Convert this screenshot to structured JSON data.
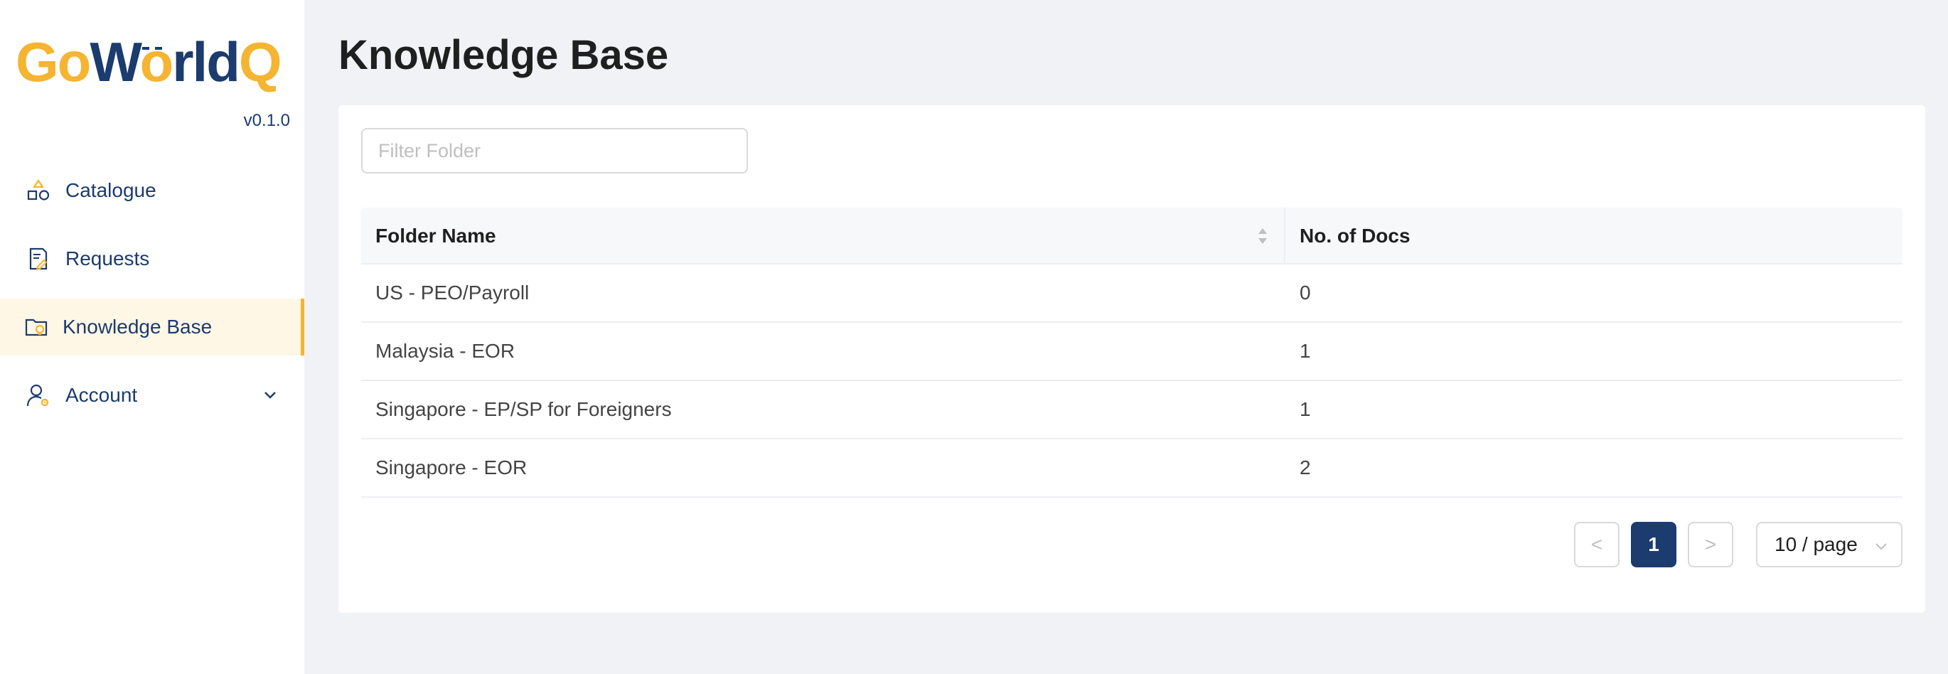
{
  "sidebar": {
    "logo_text": "GoWorldQ",
    "version": "v0.1.0",
    "items": [
      {
        "label": "Catalogue",
        "icon": "catalogue-shapes-icon",
        "active": false
      },
      {
        "label": "Requests",
        "icon": "request-document-icon",
        "active": false
      },
      {
        "label": "Knowledge Base",
        "icon": "folder-bulb-icon",
        "active": true
      },
      {
        "label": "Account",
        "icon": "user-gear-icon",
        "active": false,
        "expandable": true
      }
    ]
  },
  "page": {
    "title": "Knowledge Base"
  },
  "filter": {
    "placeholder": "Filter Folder",
    "value": ""
  },
  "table": {
    "columns": [
      "Folder Name",
      "No. of Docs"
    ],
    "rows": [
      [
        "US - PEO/Payroll",
        "0"
      ],
      [
        "Malaysia - EOR",
        "1"
      ],
      [
        "Singapore - EP/SP for Foreigners",
        "1"
      ],
      [
        "Singapore - EOR",
        "2"
      ]
    ]
  },
  "pagination": {
    "prev": "<",
    "current_page": "1",
    "next": ">",
    "page_size": "10 / page"
  },
  "colors": {
    "brand_navy": "#1c3b6e",
    "brand_yellow": "#f5b431",
    "active_bg": "#fff7e6"
  }
}
